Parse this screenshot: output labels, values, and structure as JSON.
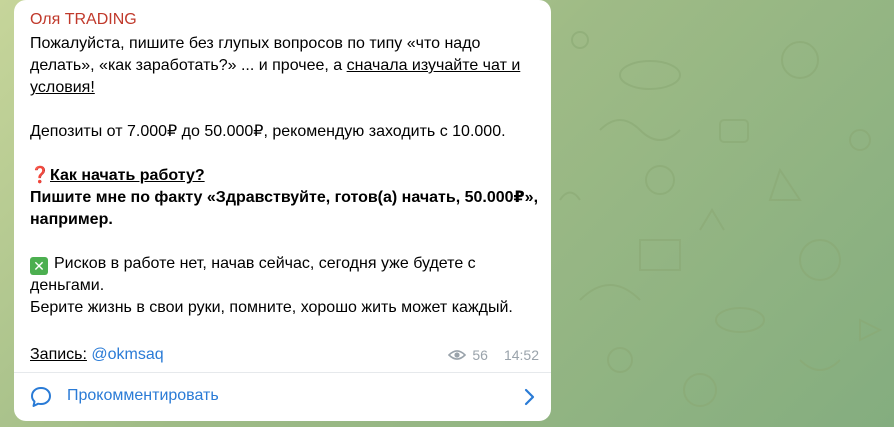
{
  "message": {
    "sender": "Оля TRADING",
    "paragraphs": {
      "p1_a": "Пожалуйста, пишите без глупых вопросов по типу «что надо делать», «как заработать?» ... и прочее, а ",
      "p1_link": "сначала изучайте чат и условия!",
      "p2": "Депозиты от 7.000₽ до 50.000₽, рекомендую заходить с 10.000.",
      "p3_title": "Как начать работу?",
      "p3_bold": "Пишите мне по факту «Здравствуйте, готов(а) начать, 50.000₽», например.",
      "p4": "Рисков в работе нет, начав сейчас, сегодня уже будете с деньгами.",
      "p5": "Берите жизнь в свои руки, помните, хорошо жить может каждый."
    },
    "record_label": "Запись:",
    "record_handle": "@okmsaq",
    "views": "56",
    "time": "14:52",
    "emoji": {
      "question": "❓",
      "cross": "✕"
    }
  },
  "footer": {
    "comment_label": "Прокомментировать"
  },
  "colors": {
    "sender": "#c0392b",
    "link": "#2a7bd6",
    "meta": "#9aa3ab",
    "background": "#9fbb86"
  },
  "icons": {
    "views": "eye-icon",
    "comment": "comment-bubble-icon",
    "chevron": "chevron-right-icon"
  }
}
